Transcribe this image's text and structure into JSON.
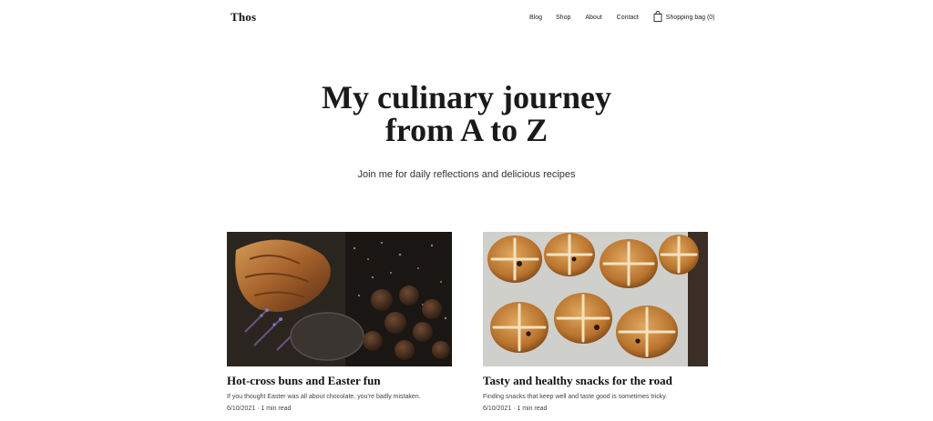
{
  "header": {
    "logo": "Thos",
    "nav": {
      "blog": "Blog",
      "shop": "Shop",
      "about": "About",
      "contact": "Contact",
      "bag": "Shopping bag (0)"
    }
  },
  "hero": {
    "title_line1": "My culinary journey",
    "title_line2": "from A to Z",
    "subtitle": "Join me for daily reflections and delicious recipes"
  },
  "posts": [
    {
      "title": "Hot-cross buns and Easter fun",
      "excerpt": "If you thought Easter was all about chocolate, you're badly mistaken.",
      "meta": "6/10/2021 · 1 min read",
      "image": "croissant-and-chocolate-truffles-photo"
    },
    {
      "title": "Tasty and healthy snacks for the road",
      "excerpt": "Finding snacks that keep well and taste good is sometimes tricky.",
      "meta": "6/10/2021 · 1 min read",
      "image": "hot-cross-buns-photo"
    }
  ]
}
